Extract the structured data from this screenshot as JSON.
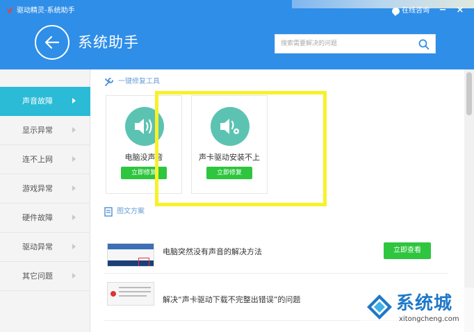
{
  "window": {
    "app_title": "驱动精灵-系统助手",
    "online_consult": "在线咨询",
    "minimize_glyph": "−",
    "close_glyph": "×"
  },
  "header": {
    "page_title": "系统助手",
    "search_placeholder": "搜索需要解决的问题"
  },
  "sidebar": {
    "items": [
      {
        "label": "声音故障",
        "active": true
      },
      {
        "label": "显示异常",
        "active": false
      },
      {
        "label": "连不上网",
        "active": false
      },
      {
        "label": "游戏异常",
        "active": false
      },
      {
        "label": "硬件故障",
        "active": false
      },
      {
        "label": "驱动异常",
        "active": false
      },
      {
        "label": "其它问题",
        "active": false
      }
    ]
  },
  "repair_section": {
    "title": "一键修复工具",
    "tools": [
      {
        "label": "电脑没声音",
        "button": "立即修复",
        "icon": "speaker-icon"
      },
      {
        "label": "声卡驱动安装不上",
        "button": "立即修复",
        "icon": "speaker-gear-icon"
      }
    ]
  },
  "articles_section": {
    "title": "图文方案",
    "items": [
      {
        "title": "电脑突然没有声音的解决方法",
        "button": "立即查看"
      },
      {
        "title": "解决“声卡驱动下载不完整出错误”的问题"
      }
    ]
  },
  "watermark": {
    "brand": "系统城",
    "url": "xitongcheng.com"
  },
  "colors": {
    "header_blue": "#2f8ee8",
    "active_teal": "#2bbbd6",
    "button_green": "#2ec53f",
    "icon_teal": "#5cc3b2",
    "highlight_yellow": "#f7f228"
  }
}
